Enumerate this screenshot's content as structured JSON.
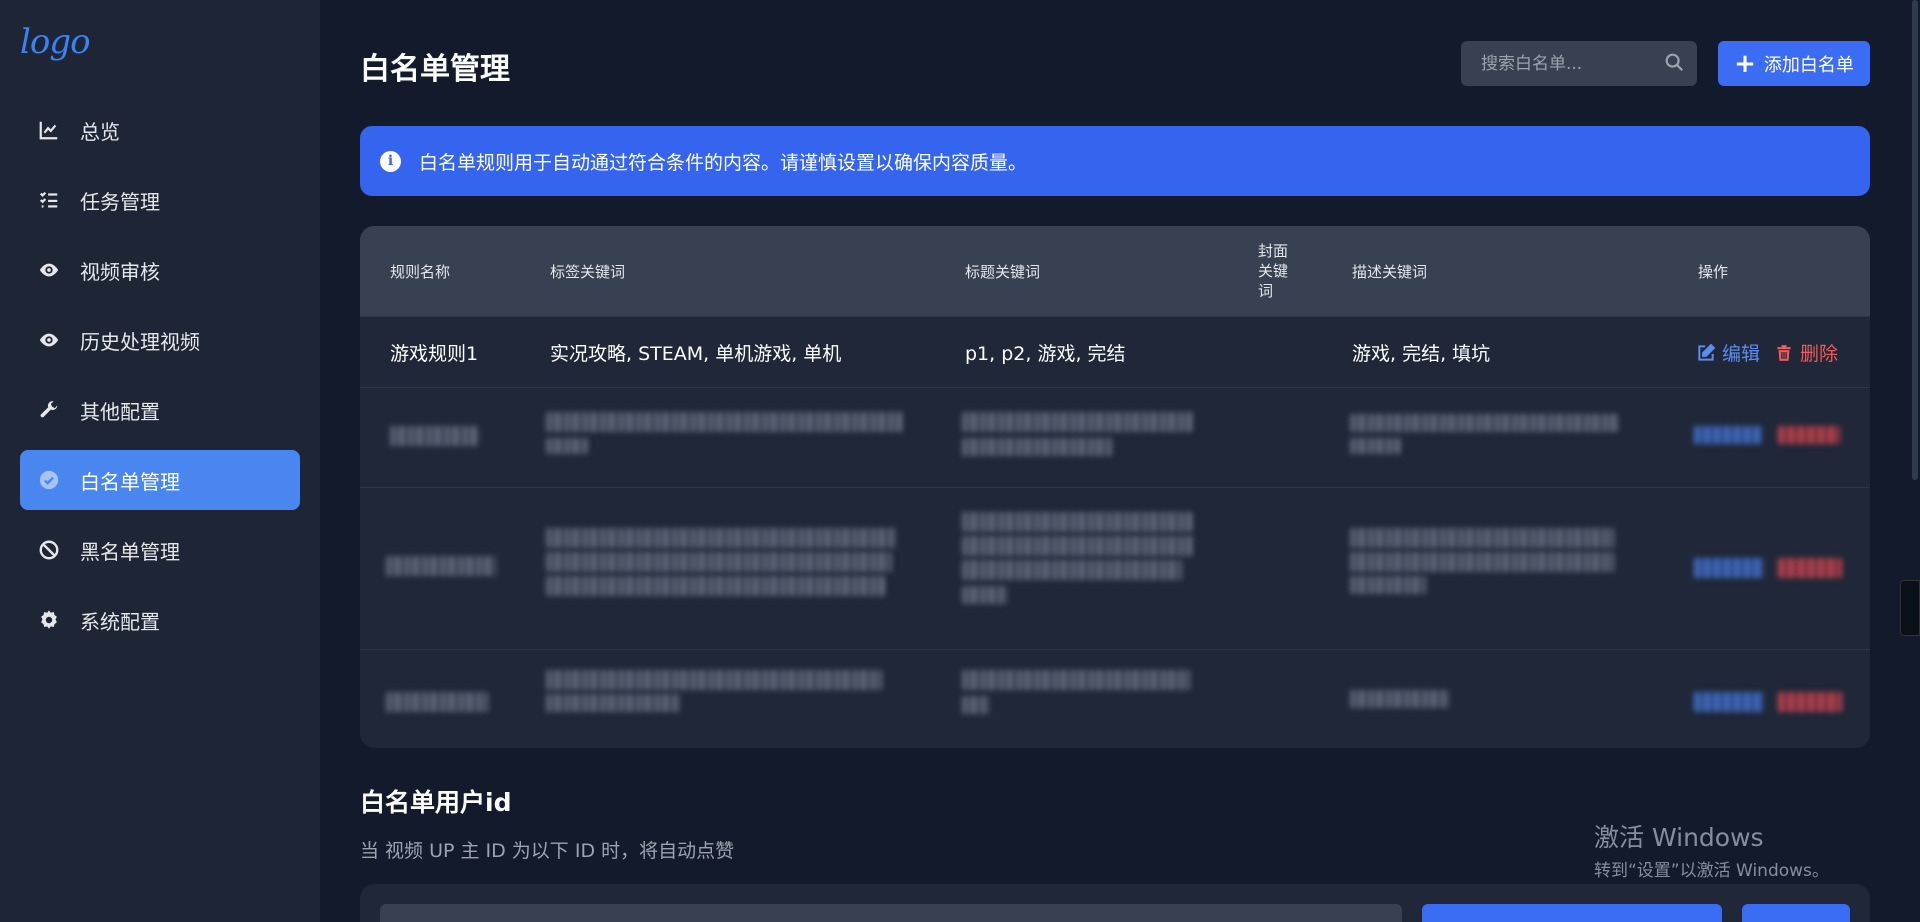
{
  "sidebar": {
    "logo": "logo",
    "items": [
      {
        "label": "总览",
        "icon": "chart-line-icon"
      },
      {
        "label": "任务管理",
        "icon": "task-list-icon"
      },
      {
        "label": "视频审核",
        "icon": "eye-icon"
      },
      {
        "label": "历史处理视频",
        "icon": "eye-icon"
      },
      {
        "label": "其他配置",
        "icon": "wrench-icon"
      },
      {
        "label": "白名单管理",
        "icon": "check-circle-icon",
        "active": true
      },
      {
        "label": "黑名单管理",
        "icon": "ban-icon"
      },
      {
        "label": "系统配置",
        "icon": "gear-icon"
      }
    ]
  },
  "header": {
    "title": "白名单管理",
    "search_placeholder": "搜索白名单...",
    "add_button_label": "添加白名单"
  },
  "banner": {
    "text": "白名单规则用于自动通过符合条件的内容。请谨慎设置以确保内容质量。"
  },
  "table": {
    "headers": {
      "rule_name": "规则名称",
      "tag_keywords": "标签关键词",
      "title_keywords": "标题关键词",
      "cover_keywords": "封面关键词",
      "desc_keywords": "描述关键词",
      "actions": "操作"
    },
    "rows": [
      {
        "rule_name": "游戏规则1",
        "tag_keywords": "实况攻略, STEAM, 单机游戏, 单机",
        "title_keywords": "p1, p2, 游戏, 完结",
        "cover_keywords": "",
        "desc_keywords": "游戏, 完结, 填坑",
        "edit_label": "编辑",
        "delete_label": "删除"
      }
    ]
  },
  "user_section": {
    "title": "白名单用户id",
    "description": "当 视频 UP 主 ID 为以下 ID 时，将自动点赞"
  },
  "watermark": {
    "line1": "激活 Windows",
    "line2": "转到“设置”以激活 Windows。"
  },
  "colors": {
    "accent": "#3b6cf4",
    "danger": "#ef5b5b",
    "background": "#121a2c",
    "sidebar": "#1e2636"
  }
}
